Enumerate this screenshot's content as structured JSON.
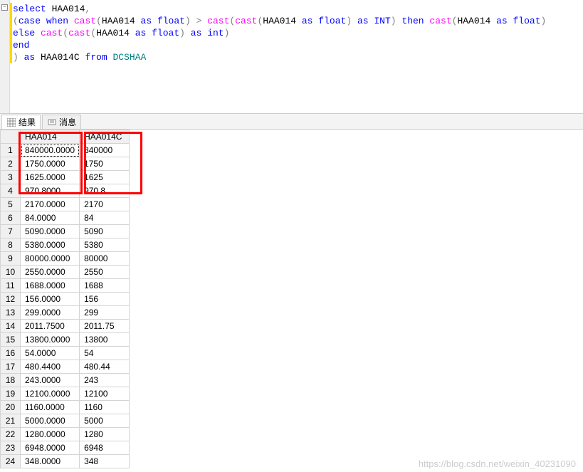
{
  "editor": {
    "collapse_glyph": "−",
    "lines": [
      [
        {
          "c": "kw-blue",
          "t": "select"
        },
        {
          "c": "kw-black",
          "t": " HAA014"
        },
        {
          "c": "kw-gray",
          "t": ","
        }
      ],
      [
        {
          "c": "kw-gray",
          "t": "("
        },
        {
          "c": "kw-blue",
          "t": "case"
        },
        {
          "c": "kw-black",
          "t": " "
        },
        {
          "c": "kw-blue",
          "t": "when"
        },
        {
          "c": "kw-black",
          "t": " "
        },
        {
          "c": "kw-pink",
          "t": "cast"
        },
        {
          "c": "kw-gray",
          "t": "("
        },
        {
          "c": "kw-black",
          "t": "HAA014 "
        },
        {
          "c": "kw-blue",
          "t": "as"
        },
        {
          "c": "kw-black",
          "t": " "
        },
        {
          "c": "kw-blue",
          "t": "float"
        },
        {
          "c": "kw-gray",
          "t": ")"
        },
        {
          "c": "kw-black",
          "t": " "
        },
        {
          "c": "kw-gray",
          "t": ">"
        },
        {
          "c": "kw-black",
          "t": " "
        },
        {
          "c": "kw-pink",
          "t": "cast"
        },
        {
          "c": "kw-gray",
          "t": "("
        },
        {
          "c": "kw-pink",
          "t": "cast"
        },
        {
          "c": "kw-gray",
          "t": "("
        },
        {
          "c": "kw-black",
          "t": "HAA014 "
        },
        {
          "c": "kw-blue",
          "t": "as"
        },
        {
          "c": "kw-black",
          "t": " "
        },
        {
          "c": "kw-blue",
          "t": "float"
        },
        {
          "c": "kw-gray",
          "t": ")"
        },
        {
          "c": "kw-black",
          "t": " "
        },
        {
          "c": "kw-blue",
          "t": "as"
        },
        {
          "c": "kw-black",
          "t": " "
        },
        {
          "c": "kw-blue",
          "t": "INT"
        },
        {
          "c": "kw-gray",
          "t": ")"
        },
        {
          "c": "kw-black",
          "t": " "
        },
        {
          "c": "kw-blue",
          "t": "then"
        },
        {
          "c": "kw-black",
          "t": " "
        },
        {
          "c": "kw-pink",
          "t": "cast"
        },
        {
          "c": "kw-gray",
          "t": "("
        },
        {
          "c": "kw-black",
          "t": "HAA014 "
        },
        {
          "c": "kw-blue",
          "t": "as"
        },
        {
          "c": "kw-black",
          "t": " "
        },
        {
          "c": "kw-blue",
          "t": "float"
        },
        {
          "c": "kw-gray",
          "t": ")"
        }
      ],
      [
        {
          "c": "kw-blue",
          "t": "else"
        },
        {
          "c": "kw-black",
          "t": " "
        },
        {
          "c": "kw-pink",
          "t": "cast"
        },
        {
          "c": "kw-gray",
          "t": "("
        },
        {
          "c": "kw-pink",
          "t": "cast"
        },
        {
          "c": "kw-gray",
          "t": "("
        },
        {
          "c": "kw-black",
          "t": "HAA014 "
        },
        {
          "c": "kw-blue",
          "t": "as"
        },
        {
          "c": "kw-black",
          "t": " "
        },
        {
          "c": "kw-blue",
          "t": "float"
        },
        {
          "c": "kw-gray",
          "t": ")"
        },
        {
          "c": "kw-black",
          "t": " "
        },
        {
          "c": "kw-blue",
          "t": "as"
        },
        {
          "c": "kw-black",
          "t": " "
        },
        {
          "c": "kw-blue",
          "t": "int"
        },
        {
          "c": "kw-gray",
          "t": ")"
        }
      ],
      [
        {
          "c": "kw-blue",
          "t": "end"
        }
      ],
      [
        {
          "c": "kw-gray",
          "t": ")"
        },
        {
          "c": "kw-black",
          "t": " "
        },
        {
          "c": "kw-blue",
          "t": "as"
        },
        {
          "c": "kw-black",
          "t": " HAA014C "
        },
        {
          "c": "kw-blue",
          "t": "from"
        },
        {
          "c": "kw-black",
          "t": " "
        },
        {
          "c": "kw-teal",
          "t": "DCSHAA"
        }
      ]
    ]
  },
  "tabs": {
    "results": "结果",
    "messages": "消息"
  },
  "grid": {
    "headers": [
      "HAA014",
      "HAA014C"
    ],
    "rows": [
      {
        "n": "1",
        "a": "840000.0000",
        "b": "840000",
        "sel": true
      },
      {
        "n": "2",
        "a": "1750.0000",
        "b": "1750"
      },
      {
        "n": "3",
        "a": "1625.0000",
        "b": "1625"
      },
      {
        "n": "4",
        "a": "970.8000",
        "b": "970.8"
      },
      {
        "n": "5",
        "a": "2170.0000",
        "b": "2170"
      },
      {
        "n": "6",
        "a": "84.0000",
        "b": "84"
      },
      {
        "n": "7",
        "a": "5090.0000",
        "b": "5090"
      },
      {
        "n": "8",
        "a": "5380.0000",
        "b": "5380"
      },
      {
        "n": "9",
        "a": "80000.0000",
        "b": "80000"
      },
      {
        "n": "10",
        "a": "2550.0000",
        "b": "2550"
      },
      {
        "n": "11",
        "a": "1688.0000",
        "b": "1688"
      },
      {
        "n": "12",
        "a": "156.0000",
        "b": "156"
      },
      {
        "n": "13",
        "a": "299.0000",
        "b": "299"
      },
      {
        "n": "14",
        "a": "2011.7500",
        "b": "2011.75"
      },
      {
        "n": "15",
        "a": "13800.0000",
        "b": "13800"
      },
      {
        "n": "16",
        "a": "54.0000",
        "b": "54"
      },
      {
        "n": "17",
        "a": "480.4400",
        "b": "480.44"
      },
      {
        "n": "18",
        "a": "243.0000",
        "b": "243"
      },
      {
        "n": "19",
        "a": "12100.0000",
        "b": "12100"
      },
      {
        "n": "20",
        "a": "1160.0000",
        "b": "1160"
      },
      {
        "n": "21",
        "a": "5000.0000",
        "b": "5000"
      },
      {
        "n": "22",
        "a": "1280.0000",
        "b": "1280"
      },
      {
        "n": "23",
        "a": "6948.0000",
        "b": "6948"
      },
      {
        "n": "24",
        "a": "348.0000",
        "b": "348"
      }
    ]
  },
  "watermark": "https://blog.csdn.net/weixin_40231090"
}
